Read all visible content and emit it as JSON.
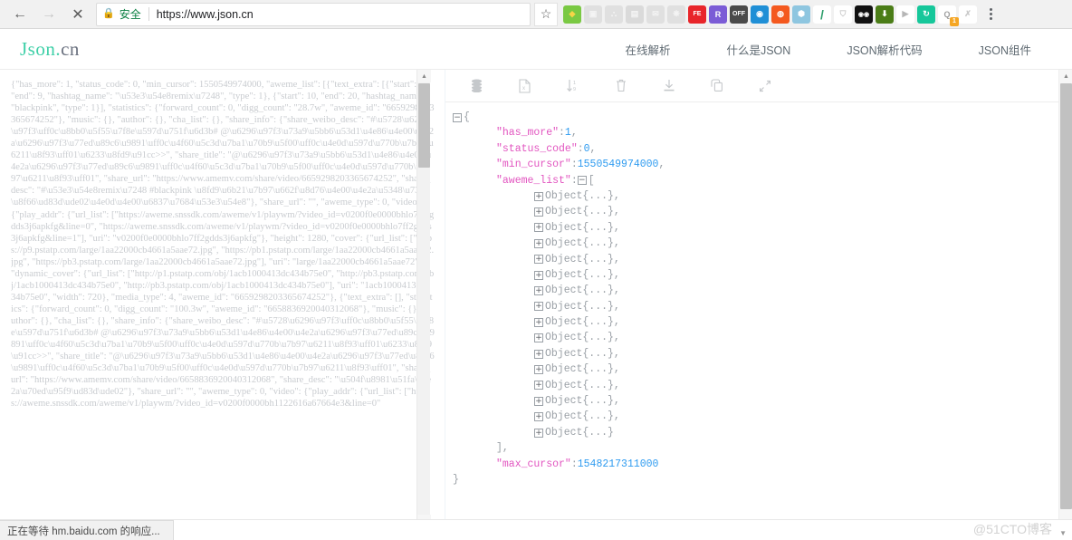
{
  "browser": {
    "back_icon": "arrow-left-icon",
    "forward_icon": "arrow-right-icon",
    "stop_icon": "close-icon",
    "lock_icon": "lock-icon",
    "secure_label": "安全",
    "url": "https://www.json.cn",
    "bookmark_icon": "star-icon",
    "menu_icon": "kebab-menu-icon",
    "extensions": [
      {
        "name": "green-shield-extension",
        "glyph": "◆",
        "bg": "#7ac943",
        "color": "#f5d547",
        "faint": false
      },
      {
        "name": "window-extension",
        "glyph": "▣",
        "bg": "#b8b8b8",
        "color": "#ffffff",
        "faint": true
      },
      {
        "name": "sitemap-extension",
        "glyph": "⛬",
        "bg": "#b8b8b8",
        "color": "#ffffff",
        "faint": true
      },
      {
        "name": "code-extension",
        "glyph": "▤",
        "bg": "#a0a0a0",
        "color": "#ffffff",
        "faint": true
      },
      {
        "name": "mail-extension",
        "glyph": "✉",
        "bg": "#b8b8b8",
        "color": "#ffffff",
        "faint": true
      },
      {
        "name": "settings-extension",
        "glyph": "❋",
        "bg": "#b8b8b8",
        "color": "#ffffff",
        "faint": true
      },
      {
        "name": "fe-extension",
        "glyph": "FE",
        "bg": "#e8252a",
        "color": "#ffffff",
        "faint": false
      },
      {
        "name": "r-extension",
        "glyph": "R",
        "bg": "#7b5cd6",
        "color": "#ffffff",
        "faint": false
      },
      {
        "name": "off-extension",
        "glyph": "OFF",
        "bg": "#4a4a4a",
        "color": "#ffffff",
        "faint": false
      },
      {
        "name": "blue-circle-extension",
        "glyph": "◉",
        "bg": "#1f8fd6",
        "color": "#ffffff",
        "faint": false
      },
      {
        "name": "orange-circle-extension",
        "glyph": "◍",
        "bg": "#f4591f",
        "color": "#ffffff",
        "faint": false
      },
      {
        "name": "globe-extension",
        "glyph": "⬢",
        "bg": "#8ec6e0",
        "color": "#ffffff",
        "faint": false
      },
      {
        "name": "slash-extension",
        "glyph": "/",
        "bg": "#ffffff",
        "color": "#2e9e6b",
        "faint": false
      },
      {
        "name": "shield-extension",
        "glyph": "⛉",
        "bg": "#ffffff",
        "color": "#c9c9c9",
        "faint": false
      },
      {
        "name": "eyes-extension",
        "glyph": "◉◉",
        "bg": "#111111",
        "color": "#ffffff",
        "faint": false
      },
      {
        "name": "download-extension",
        "glyph": "⬇",
        "bg": "#4b7d17",
        "color": "#ffffff",
        "faint": false
      },
      {
        "name": "play-extension",
        "glyph": "▶",
        "bg": "#ffffff",
        "color": "#b6b6b6",
        "faint": false
      },
      {
        "name": "refresh-extension",
        "glyph": "↻",
        "bg": "#16c79a",
        "color": "#ffffff",
        "faint": false
      },
      {
        "name": "q-extension",
        "glyph": "Q",
        "bg": "#ffffff",
        "color": "#9e9e9e",
        "faint": false,
        "badge": "1"
      },
      {
        "name": "x-extension",
        "glyph": "✗",
        "bg": "#ffffff",
        "color": "#c9c9c9",
        "faint": false
      }
    ]
  },
  "site": {
    "logo_primary": "Json.",
    "logo_secondary": "cn",
    "nav": [
      {
        "label": "在线解析",
        "name": "nav-online-parse"
      },
      {
        "label": "什么是JSON",
        "name": "nav-what-is-json"
      },
      {
        "label": "JSON解析代码",
        "name": "nav-parse-code"
      },
      {
        "label": "JSON组件",
        "name": "nav-components"
      }
    ]
  },
  "tree_toolbar": [
    {
      "name": "database-icon",
      "title": "数据库"
    },
    {
      "name": "export-excel-icon",
      "title": "导出"
    },
    {
      "name": "sort-icon",
      "title": "排序"
    },
    {
      "name": "delete-icon",
      "title": "清空"
    },
    {
      "name": "download-icon",
      "title": "下载"
    },
    {
      "name": "copy-icon",
      "title": "复制"
    },
    {
      "name": "collapse-icon",
      "title": "折叠"
    }
  ],
  "editor": {
    "raw_json": "{\"has_more\": 1, \"status_code\": 0, \"min_cursor\": 1550549974000, \"aweme_list\": [{\"text_extra\": [{\"start\": 0, \"end\": 9, \"hashtag_name\": \"\\u53e3\\u54e8remix\\u7248\", \"type\": 1}, {\"start\": 10, \"end\": 20, \"hashtag_name\": \"blackpink\", \"type\": 1}], \"statistics\": {\"forward_count\": 0, \"digg_count\": \"28.7w\", \"aweme_id\": \"6659298203365674252\"}, \"music\": {}, \"author\": {}, \"cha_list\": {}, \"share_info\": {\"share_weibo_desc\": \"#\\u5728\\u6296\\u97f3\\uff0c\\u8bb0\\u5f55\\u7f8e\\u597d\\u751f\\u6d3b# @\\u6296\\u97f3\\u73a9\\u5bb6\\u53d1\\u4e86\\u4e00\\u4e2a\\u6296\\u97f3\\u77ed\\u89c6\\u9891\\uff0c\\u4f60\\u5c3d\\u7ba1\\u70b9\\u5f00\\uff0c\\u4e0d\\u597d\\u770b\\u7b97\\u6211\\u8f93\\uff01\\u6233\\u8fd9\\u91cc>>\", \"share_title\": \"@\\u6296\\u97f3\\u73a9\\u5bb6\\u53d1\\u4e86\\u4e00\\u4e2a\\u6296\\u97f3\\u77ed\\u89c6\\u9891\\uff0c\\u4f60\\u5c3d\\u7ba1\\u70b9\\u5f00\\uff0c\\u4e0d\\u597d\\u770b\\u7b97\\u6211\\u8f93\\uff01\", \"share_url\": \"https://www.amemv.com/share/video/6659298203365674252\", \"share_desc\": \"#\\u53e3\\u54e8remix\\u7248 #blackpink \\u8fd9\\u6b21\\u7b97\\u662f\\u8d76\\u4e00\\u4e2a\\u5348\\u73ed\\u8f66\\ud83d\\ude02\\u4e0d\\u4e00\\u6837\\u7684\\u53e3\\u54e8\"}, \"share_url\": \"\", \"aweme_type\": 0, \"video\": {\"play_addr\": {\"url_list\": [\"https://aweme.snssdk.com/aweme/v1/playwm/?video_id=v0200f0e0000bhlo7ff2gdds3j6apkfg&line=0\", \"https://aweme.snssdk.com/aweme/v1/playwm/?video_id=v0200f0e0000bhlo7ff2gdds3j6apkfg&line=1\"], \"uri\": \"v0200f0e0000bhlo7ff2gdds3j6apkfg\"}, \"height\": 1280, \"cover\": {\"url_list\": [\"https://p9.pstatp.com/large/1aa22000cb4661a5aae72.jpg\", \"https://pb1.pstatp.com/large/1aa22000cb4661a5aae72.jpg\", \"https://pb3.pstatp.com/large/1aa22000cb4661a5aae72.jpg\"], \"uri\": \"large/1aa22000cb4661a5aae72\"}, \"dynamic_cover\": {\"url_list\": [\"http://p1.pstatp.com/obj/1acb1000413dc434b75e0\", \"http://pb3.pstatp.com/obj/1acb1000413dc434b75e0\", \"http://pb3.pstatp.com/obj/1acb1000413dc434b75e0\"], \"uri\": \"1acb1000413dc434b75e0\", \"width\": 720}, \"media_type\": 4, \"aweme_id\": \"6659298203365674252\"}, {\"text_extra\": [], \"statistics\": {\"forward_count\": 0, \"digg_count\": \"100.3w\", \"aweme_id\": \"6658836920040312068\"}, \"music\": {}, \"author\": {}, \"cha_list\": {}, \"share_info\": {\"share_weibo_desc\": \"#\\u5728\\u6296\\u97f3\\uff0c\\u8bb0\\u5f55\\u7f8e\\u597d\\u751f\\u6d3b# @\\u6296\\u97f3\\u73a9\\u5bb6\\u53d1\\u4e86\\u4e00\\u4e2a\\u6296\\u97f3\\u77ed\\u89c6\\u9891\\uff0c\\u4f60\\u5c3d\\u7ba1\\u70b9\\u5f00\\uff0c\\u4e0d\\u597d\\u770b\\u7b97\\u6211\\u8f93\\uff01\\u6233\\u8fd9\\u91cc>>\", \"share_title\": \"@\\u6296\\u97f3\\u73a9\\u5bb6\\u53d1\\u4e86\\u4e00\\u4e2a\\u6296\\u97f3\\u77ed\\u89c6\\u9891\\uff0c\\u4f60\\u5c3d\\u7ba1\\u70b9\\u5f00\\uff0c\\u4e0d\\u597d\\u770b\\u7b97\\u6211\\u8f93\\uff01\", \"share_url\": \"https://www.amemv.com/share/video/6658836920040312068\", \"share_desc\": \"\\u504f\\u8981\\u51fa\\u4e2a\\u70ed\\u95f9\\ud83d\\ude02\"}, \"share_url\": \"\", \"aweme_type\": 0, \"video\": {\"play_addr\": {\"url_list\": [\"https://aweme.snssdk.com/aweme/v1/playwm/?video_id=v0200f0000bh1122616a67664e3&line=0\""
  },
  "tree": {
    "root_open_brace": "{",
    "root_close_brace": "}",
    "rows": [
      {
        "key": "\"has_more\"",
        "sep": ":",
        "value": "1",
        "comma": ","
      },
      {
        "key": "\"status_code\"",
        "sep": ":",
        "value": "0",
        "comma": ","
      },
      {
        "key": "\"min_cursor\"",
        "sep": ":",
        "value": "1550549974000",
        "comma": ","
      }
    ],
    "array_key": "\"aweme_list\"",
    "array_open": "[",
    "array_close": "]",
    "array_close_comma": ",",
    "object_label": "Object{...}",
    "object_comma": ",",
    "object_count": 16,
    "last_row": {
      "key": "\"max_cursor\"",
      "sep": ":",
      "value": "1548217311000"
    },
    "toggle_collapse": "−",
    "toggle_expand": "+"
  },
  "statusbar": {
    "text": "正在等待 hm.baidu.com 的响应..."
  },
  "watermark": {
    "text": "@51CTO博客"
  },
  "colors": {
    "key": "#e255c0",
    "value_number": "#2e9bf0",
    "logo_accent": "#3fd0a8",
    "secure_green": "#0b8043"
  }
}
